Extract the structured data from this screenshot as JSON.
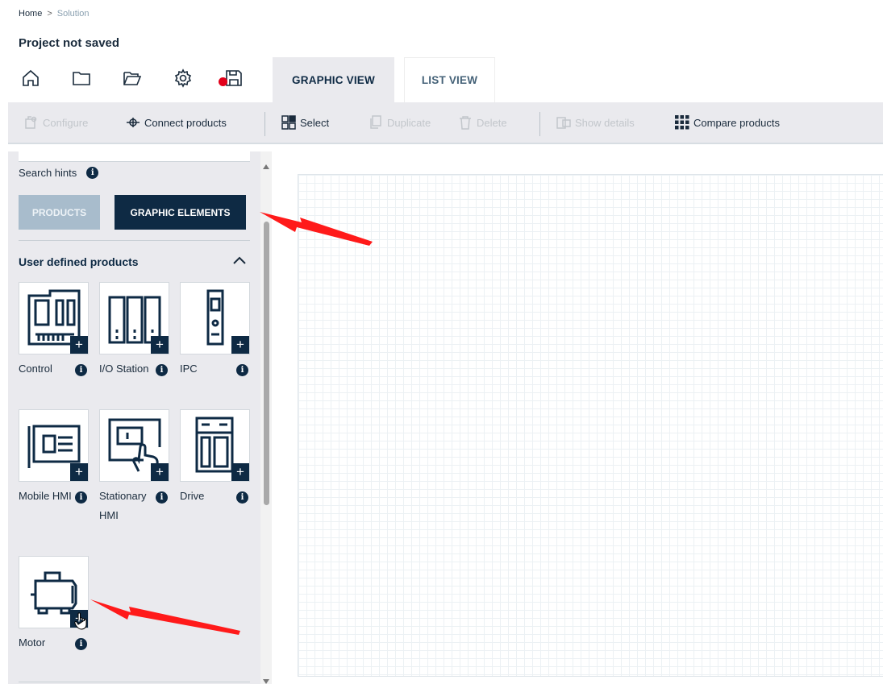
{
  "breadcrumb": {
    "home": "Home",
    "separator": ">",
    "current": "Solution"
  },
  "page_title": "Project not saved",
  "icons": [
    "home-icon",
    "folder-icon",
    "folder-open-icon",
    "gear-icon",
    "save-icon"
  ],
  "view_tabs": {
    "graphic": "GRAPHIC VIEW",
    "list": "LIST VIEW"
  },
  "toolbar": {
    "configure": "Configure",
    "connect": "Connect products",
    "select": "Select",
    "duplicate": "Duplicate",
    "delete": "Delete",
    "show_details": "Show details",
    "compare": "Compare products"
  },
  "sidebar": {
    "search_hints": "Search hints",
    "info_glyph": "i",
    "seg_products": "PRODUCTS",
    "seg_graphic": "GRAPHIC ELEMENTS",
    "section_title": "User defined products",
    "plus_glyph": "+",
    "tiles": [
      {
        "label": "Control"
      },
      {
        "label": "I/O Station"
      },
      {
        "label": "IPC"
      },
      {
        "label": "Mobile HMI"
      },
      {
        "label": "Stationary HMI"
      },
      {
        "label": "Drive"
      },
      {
        "label": "Motor"
      }
    ]
  },
  "colors": {
    "navy": "#0e2a44",
    "accent_red": "#e2001a",
    "annotation_arrow": "#ff1a1a",
    "segment_inactive": "#a8bccc"
  }
}
